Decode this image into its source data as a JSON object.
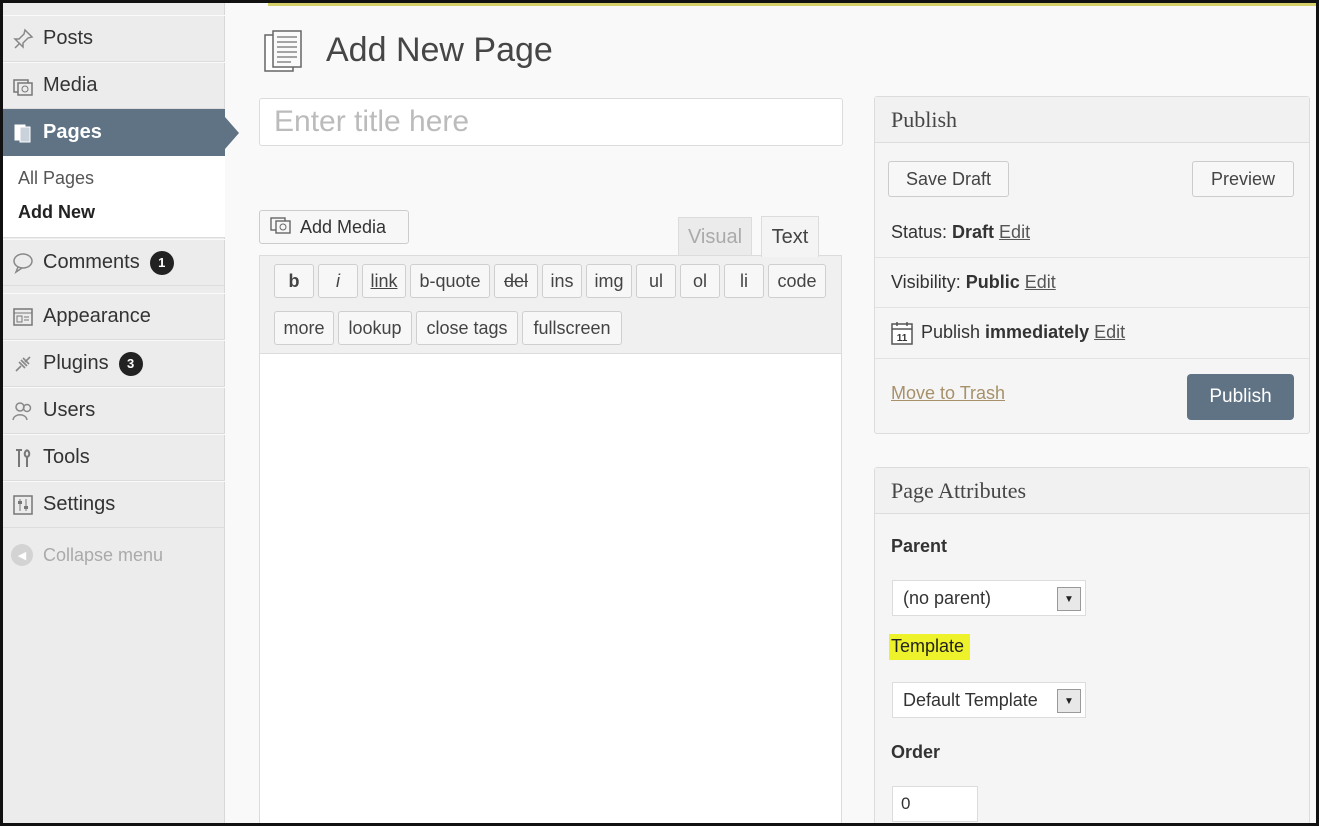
{
  "sidebar": {
    "items": [
      {
        "label": "Posts",
        "icon": "pin-icon"
      },
      {
        "label": "Media",
        "icon": "media-icon"
      },
      {
        "label": "Pages",
        "icon": "pages-icon"
      },
      {
        "label": "Comments",
        "icon": "comment-icon",
        "badge": "1"
      },
      {
        "label": "Appearance",
        "icon": "appearance-icon"
      },
      {
        "label": "Plugins",
        "icon": "plugin-icon",
        "badge": "3"
      },
      {
        "label": "Users",
        "icon": "users-icon"
      },
      {
        "label": "Tools",
        "icon": "tools-icon"
      },
      {
        "label": "Settings",
        "icon": "settings-icon"
      }
    ],
    "submenu": [
      "All Pages",
      "Add New"
    ],
    "collapse_label": "Collapse menu"
  },
  "page": {
    "title": "Add New Page",
    "title_placeholder": "Enter title here"
  },
  "editor": {
    "add_media_label": "Add Media",
    "tabs": [
      "Visual",
      "Text"
    ],
    "buttons_row1": [
      "b",
      "i",
      "link",
      "b-quote",
      "del",
      "ins",
      "img",
      "ul",
      "ol",
      "li",
      "code"
    ],
    "buttons_row2": [
      "more",
      "lookup",
      "close tags",
      "fullscreen"
    ]
  },
  "publish": {
    "heading": "Publish",
    "save_draft": "Save Draft",
    "preview": "Preview",
    "status_label": "Status:",
    "status_value": "Draft",
    "visibility_label": "Visibility:",
    "visibility_value": "Public",
    "schedule_label": "Publish",
    "schedule_value": "immediately",
    "schedule_icon_day": "11",
    "edit_label": "Edit",
    "trash_label": "Move to Trash",
    "publish_label": "Publish"
  },
  "attributes": {
    "heading": "Page Attributes",
    "parent_label": "Parent",
    "parent_value": "(no parent)",
    "template_label": "Template",
    "template_value": "Default Template",
    "order_label": "Order",
    "order_value": "0"
  },
  "colors": {
    "accent": "#5f7385",
    "highlight": "#eef22a"
  }
}
